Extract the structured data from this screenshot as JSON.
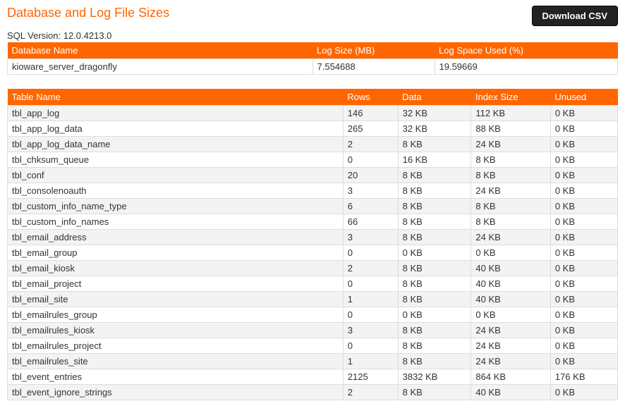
{
  "header": {
    "title": "Database and Log File Sizes",
    "download_label": "Download CSV",
    "sql_version_label": "SQL Version: 12.0.4213.0"
  },
  "db_table": {
    "headers": [
      "Database Name",
      "Log Size (MB)",
      "Log Space Used (%)"
    ],
    "rows": [
      {
        "name": "kioware_server_dragonfly",
        "log_size": "7.554688",
        "log_space": "19.59669"
      }
    ]
  },
  "tbl_table": {
    "headers": [
      "Table Name",
      "Rows",
      "Data",
      "Index Size",
      "Unused"
    ],
    "rows": [
      {
        "name": "tbl_app_log",
        "rows": "146",
        "data": "32 KB",
        "index": "112 KB",
        "unused": "0 KB"
      },
      {
        "name": "tbl_app_log_data",
        "rows": "265",
        "data": "32 KB",
        "index": "88 KB",
        "unused": "0 KB"
      },
      {
        "name": "tbl_app_log_data_name",
        "rows": "2",
        "data": "8 KB",
        "index": "24 KB",
        "unused": "0 KB"
      },
      {
        "name": "tbl_chksum_queue",
        "rows": "0",
        "data": "16 KB",
        "index": "8 KB",
        "unused": "0 KB"
      },
      {
        "name": "tbl_conf",
        "rows": "20",
        "data": "8 KB",
        "index": "8 KB",
        "unused": "0 KB"
      },
      {
        "name": "tbl_consolenoauth",
        "rows": "3",
        "data": "8 KB",
        "index": "24 KB",
        "unused": "0 KB"
      },
      {
        "name": "tbl_custom_info_name_type",
        "rows": "6",
        "data": "8 KB",
        "index": "8 KB",
        "unused": "0 KB"
      },
      {
        "name": "tbl_custom_info_names",
        "rows": "66",
        "data": "8 KB",
        "index": "8 KB",
        "unused": "0 KB"
      },
      {
        "name": "tbl_email_address",
        "rows": "3",
        "data": "8 KB",
        "index": "24 KB",
        "unused": "0 KB"
      },
      {
        "name": "tbl_email_group",
        "rows": "0",
        "data": "0 KB",
        "index": "0 KB",
        "unused": "0 KB"
      },
      {
        "name": "tbl_email_kiosk",
        "rows": "2",
        "data": "8 KB",
        "index": "40 KB",
        "unused": "0 KB"
      },
      {
        "name": "tbl_email_project",
        "rows": "0",
        "data": "8 KB",
        "index": "40 KB",
        "unused": "0 KB"
      },
      {
        "name": "tbl_email_site",
        "rows": "1",
        "data": "8 KB",
        "index": "40 KB",
        "unused": "0 KB"
      },
      {
        "name": "tbl_emailrules_group",
        "rows": "0",
        "data": "0 KB",
        "index": "0 KB",
        "unused": "0 KB"
      },
      {
        "name": "tbl_emailrules_kiosk",
        "rows": "3",
        "data": "8 KB",
        "index": "24 KB",
        "unused": "0 KB"
      },
      {
        "name": "tbl_emailrules_project",
        "rows": "0",
        "data": "8 KB",
        "index": "24 KB",
        "unused": "0 KB"
      },
      {
        "name": "tbl_emailrules_site",
        "rows": "1",
        "data": "8 KB",
        "index": "24 KB",
        "unused": "0 KB"
      },
      {
        "name": "tbl_event_entries",
        "rows": "2125",
        "data": "3832 KB",
        "index": "864 KB",
        "unused": "176 KB"
      },
      {
        "name": "tbl_event_ignore_strings",
        "rows": "2",
        "data": "8 KB",
        "index": "40 KB",
        "unused": "0 KB"
      }
    ]
  }
}
